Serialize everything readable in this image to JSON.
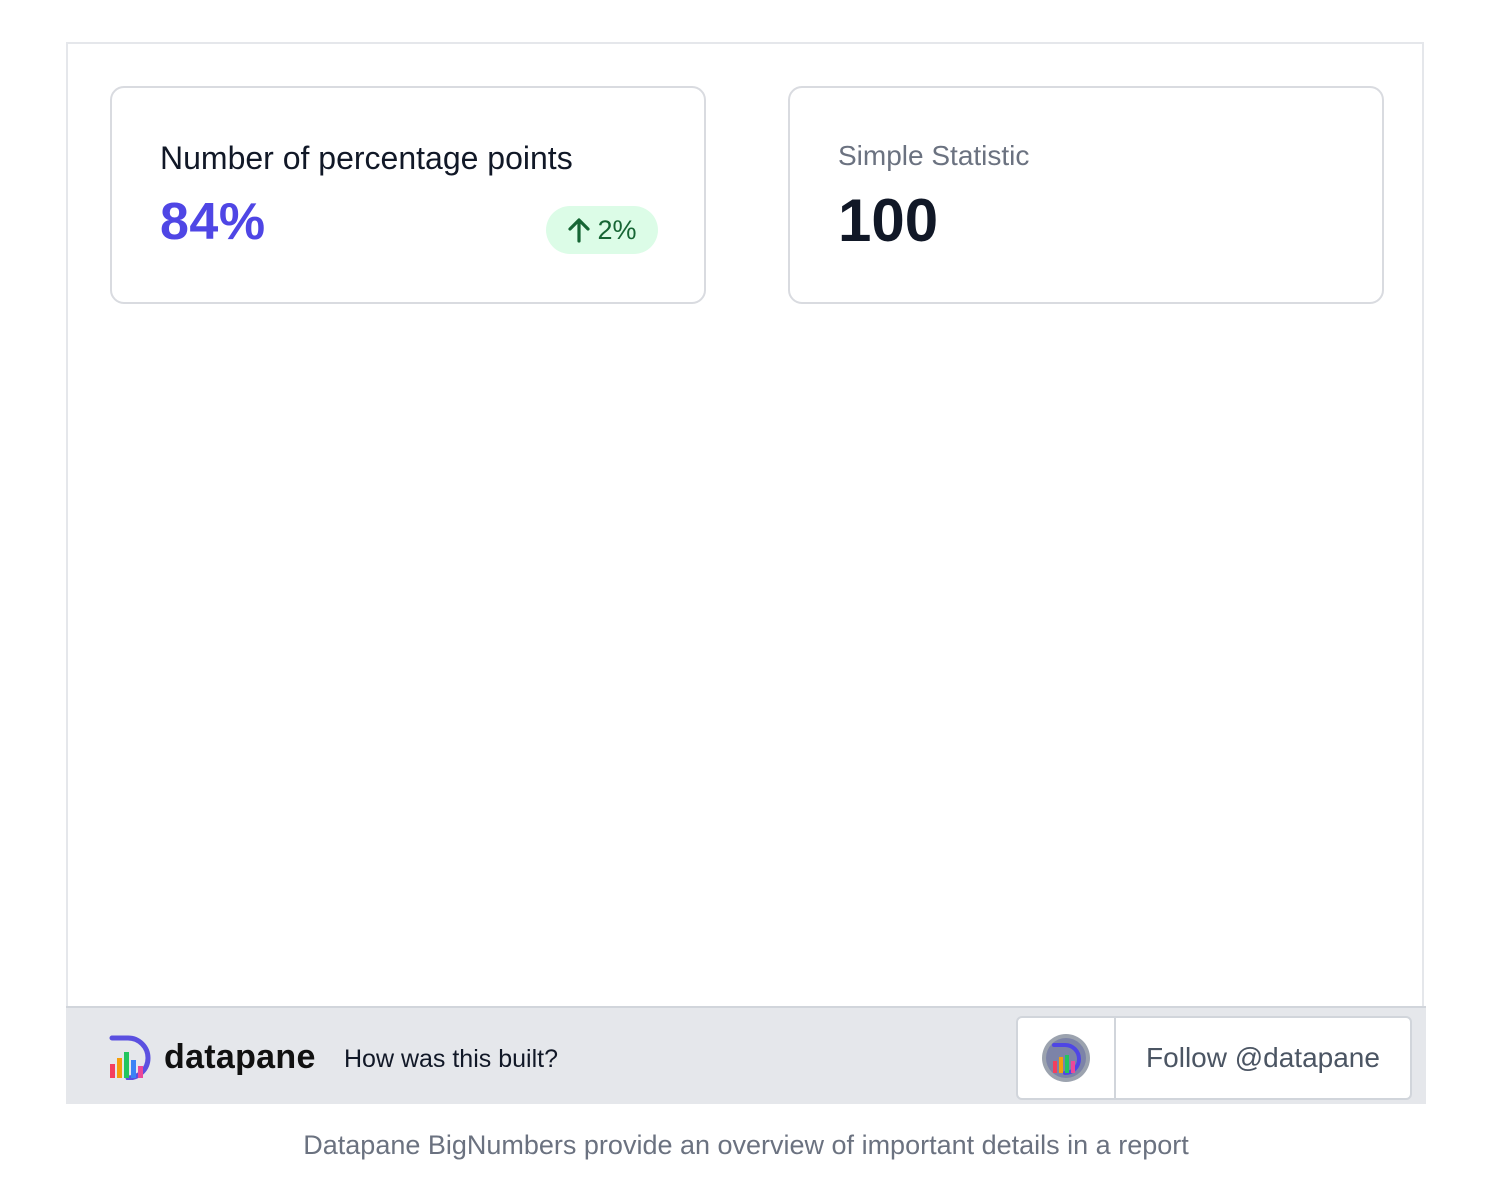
{
  "cards": [
    {
      "label": "Number of percentage points",
      "value": "84%",
      "change": {
        "direction_icon": "arrow-up-icon",
        "text": "2%",
        "color": "#166534",
        "background": "#dcfce7"
      },
      "value_color": "#4f46e5"
    },
    {
      "label": "Simple Statistic",
      "value": "100",
      "value_color": "#111827"
    }
  ],
  "footer": {
    "logo_icon": "datapane-logo-icon",
    "brand": "datapane",
    "how_link": "How was this built?",
    "avatar_icon": "datapane-avatar-icon",
    "follow_label": "Follow @datapane"
  },
  "caption": "Datapane BigNumbers provide an overview of important details in a report"
}
